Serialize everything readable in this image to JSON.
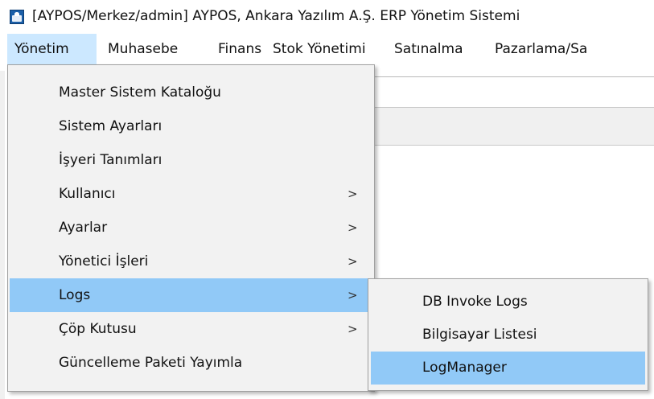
{
  "window": {
    "title": "[AYPOS/Merkez/admin] AYPOS, Ankara Yazılım A.Ş. ERP Yönetim Sistemi",
    "icon": "app-icon"
  },
  "menubar": {
    "items": [
      {
        "label": "Yönetim",
        "active": true
      },
      {
        "label": "Muhasebe"
      },
      {
        "label": "Finans"
      },
      {
        "label": "Stok Yönetimi"
      },
      {
        "label": "Satınalma"
      },
      {
        "label": "Pazarlama/Sa"
      }
    ]
  },
  "dropdown": {
    "items": [
      {
        "label": "Master Sistem Kataloğu"
      },
      {
        "label": "Sistem Ayarları"
      },
      {
        "label": "İşyeri Tanımları"
      },
      {
        "label": "Kullanıcı",
        "submenu_arrow": ">"
      },
      {
        "label": "Ayarlar",
        "submenu_arrow": ">"
      },
      {
        "label": "Yönetici İşleri",
        "submenu_arrow": ">"
      },
      {
        "label": "Logs",
        "submenu_arrow": ">",
        "highlighted": true
      },
      {
        "label": "Çöp Kutusu",
        "submenu_arrow": ">"
      },
      {
        "label": "Güncelleme Paketi Yayımla"
      }
    ]
  },
  "submenu": {
    "items": [
      {
        "label": "DB Invoke Logs"
      },
      {
        "label": "Bilgisayar Listesi"
      },
      {
        "label": "LogManager",
        "highlighted": true
      }
    ]
  },
  "colors": {
    "menu_active": "#cce8ff",
    "item_highlight": "#91c9f7",
    "menu_background": "#f2f2f2"
  }
}
